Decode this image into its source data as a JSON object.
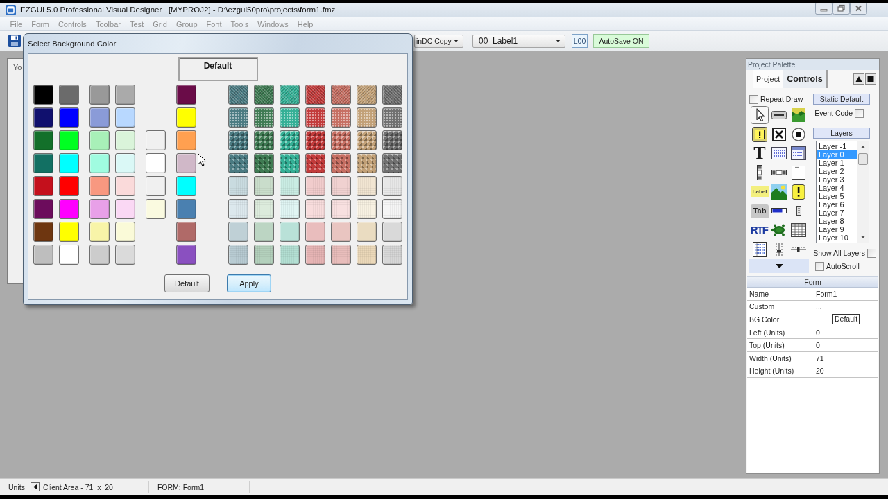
{
  "window": {
    "title": "EZGUI 5.0 Professional Visual Designer   [MYPROJ2] - D:\\ezgui50pro\\projects\\form1.fmz"
  },
  "menu": [
    {
      "label": "File",
      "disabled": true
    },
    {
      "label": "Form",
      "disabled": true
    },
    {
      "label": "Controls",
      "disabled": true
    },
    {
      "label": "Toolbar",
      "disabled": true
    },
    {
      "label": "Test",
      "disabled": true
    },
    {
      "label": "Grid",
      "disabled": true
    },
    {
      "label": "Group",
      "disabled": true
    },
    {
      "label": "Font",
      "disabled": true
    },
    {
      "label": "Tools",
      "disabled": true
    },
    {
      "label": "Windows",
      "disabled": true
    },
    {
      "label": "Help",
      "disabled": true
    }
  ],
  "toolbar": {
    "copy_mode": "inDC Copy",
    "control_select": "00  Label1",
    "layer_badge": "L00",
    "autosave": "AutoSave ON"
  },
  "form_window": {
    "text": "Yo"
  },
  "dialog": {
    "title": "Select Background Color",
    "preview": "Default",
    "basic_groups": [
      {
        "columns": [
          [
            {
              "color": "#000000"
            },
            {
              "color": "#10106e"
            },
            {
              "color": "#13702a"
            },
            {
              "color": "#127063"
            },
            {
              "color": "#c4101c"
            },
            {
              "color": "#6c0c5c"
            },
            {
              "color": "#6e3610"
            },
            {
              "color": "#bebebe"
            }
          ],
          [
            {
              "color": "#6b6b6b"
            },
            {
              "color": "#0000ff"
            },
            {
              "color": "#00ff22"
            },
            {
              "color": "#00ffff"
            },
            {
              "color": "#ff0000"
            },
            {
              "color": "#ff00ff"
            },
            {
              "color": "#ffff00"
            },
            {
              "color": "#ffffff"
            }
          ]
        ]
      },
      {
        "columns": [
          [
            {
              "color": "#999999"
            },
            {
              "color": "#8a9bd8"
            },
            {
              "color": "#a8f0b8"
            },
            {
              "color": "#a0fce0"
            },
            {
              "color": "#f89880"
            },
            {
              "color": "#e8a0e8"
            },
            {
              "color": "#f8f4a8"
            },
            {
              "color": "#cccccc"
            }
          ],
          [
            {
              "color": "#aaaaaa"
            },
            {
              "color": "#b8d8ff"
            },
            {
              "color": "#daf4da"
            },
            {
              "color": "#daf8f6"
            },
            {
              "color": "#fadada"
            },
            {
              "color": "#fad8f4"
            },
            {
              "color": "#fafad8"
            },
            {
              "color": "#dadada"
            }
          ]
        ]
      },
      {
        "columns": [
          [
            {
              "color": "#f0f0f0"
            },
            {
              "color": "#ffffff"
            },
            {
              "color": "#f0f0f0"
            },
            {
              "color": "#fafae0"
            }
          ]
        ]
      },
      {
        "columns": [
          [
            {
              "color": "#6a0c48"
            },
            {
              "color": "#ffff00"
            },
            {
              "color": "#ffa050"
            },
            {
              "color": "#d0b8c8"
            },
            {
              "color": "#00ffff"
            },
            {
              "color": "#4a80b0"
            },
            {
              "color": "#b06a68"
            },
            {
              "color": "#8a50c0"
            }
          ]
        ]
      }
    ],
    "textured_columns": [
      [
        {
          "color": "#4b7b82",
          "kind": "mesh"
        },
        {
          "color": "#4b7b82",
          "kind": "dots"
        },
        {
          "color": "#4b7b82",
          "kind": "studs"
        },
        {
          "color": "#4b7b82",
          "kind": "pyramids"
        },
        {
          "color": "#c9dbe0",
          "kind": "speckle"
        },
        {
          "color": "#dce8ed",
          "kind": "speckle"
        },
        {
          "color": "#bfd0d6",
          "kind": "solid"
        },
        {
          "color": "#b8cbd2",
          "kind": "speckle"
        }
      ],
      [
        {
          "color": "#3f7b53",
          "kind": "mesh"
        },
        {
          "color": "#3f7b53",
          "kind": "dots"
        },
        {
          "color": "#3f7b53",
          "kind": "studs"
        },
        {
          "color": "#3f7b53",
          "kind": "pyramids"
        },
        {
          "color": "#c9ddcb",
          "kind": "speckle"
        },
        {
          "color": "#dcebdc",
          "kind": "speckle"
        },
        {
          "color": "#bcd5c3",
          "kind": "solid"
        },
        {
          "color": "#b3d0bc",
          "kind": "speckle"
        }
      ],
      [
        {
          "color": "#35b096",
          "kind": "mesh"
        },
        {
          "color": "#35b096",
          "kind": "dots"
        },
        {
          "color": "#35b096",
          "kind": "studs"
        },
        {
          "color": "#35b096",
          "kind": "pyramids"
        },
        {
          "color": "#c9ece3",
          "kind": "speckle"
        },
        {
          "color": "#e0f5f3",
          "kind": "speckle"
        },
        {
          "color": "#b9e1d8",
          "kind": "solid"
        },
        {
          "color": "#b3dfd3",
          "kind": "speckle"
        }
      ],
      [
        {
          "color": "#c23b3b",
          "kind": "mesh"
        },
        {
          "color": "#c23b3b",
          "kind": "dots"
        },
        {
          "color": "#c23b3b",
          "kind": "studs"
        },
        {
          "color": "#c23b3b",
          "kind": "pyramids"
        },
        {
          "color": "#f1cccc",
          "kind": "speckle"
        },
        {
          "color": "#f8dcdc",
          "kind": "speckle"
        },
        {
          "color": "#e9bdbd",
          "kind": "solid"
        },
        {
          "color": "#e6b4b4",
          "kind": "speckle"
        }
      ],
      [
        {
          "color": "#c66f63",
          "kind": "mesh"
        },
        {
          "color": "#c66f63",
          "kind": "dots"
        },
        {
          "color": "#c66f63",
          "kind": "studs"
        },
        {
          "color": "#c66f63",
          "kind": "pyramids"
        },
        {
          "color": "#f0d1d0",
          "kind": "speckle"
        },
        {
          "color": "#f8e0e0",
          "kind": "speckle"
        },
        {
          "color": "#e9c5c1",
          "kind": "solid"
        },
        {
          "color": "#e8bdbb",
          "kind": "speckle"
        }
      ],
      [
        {
          "color": "#c2a178",
          "kind": "mesh"
        },
        {
          "color": "#c2a178",
          "kind": "dots"
        },
        {
          "color": "#c2a178",
          "kind": "studs"
        },
        {
          "color": "#c2a178",
          "kind": "pyramids"
        },
        {
          "color": "#f1e5d2",
          "kind": "speckle"
        },
        {
          "color": "#f8f1e2",
          "kind": "speckle"
        },
        {
          "color": "#eadcc1",
          "kind": "solid"
        },
        {
          "color": "#ebd8b9",
          "kind": "speckle"
        }
      ],
      [
        {
          "color": "#707070",
          "kind": "mesh"
        },
        {
          "color": "#707070",
          "kind": "dots"
        },
        {
          "color": "#707070",
          "kind": "studs"
        },
        {
          "color": "#707070",
          "kind": "pyramids"
        },
        {
          "color": "#e7e7e7",
          "kind": "speckle"
        },
        {
          "color": "#f5f5f5",
          "kind": "speckle"
        },
        {
          "color": "#d9d9d9",
          "kind": "solid"
        },
        {
          "color": "#d7d7d7",
          "kind": "speckle"
        }
      ]
    ],
    "buttons": [
      {
        "label": "Default",
        "focused": false
      },
      {
        "label": "Apply",
        "focused": true
      }
    ]
  },
  "palette": {
    "title": "Project Palette",
    "tabs": [
      {
        "label": "Project",
        "selected": false
      },
      {
        "label": "Controls",
        "selected": true
      }
    ],
    "repeat_draw": {
      "label": "Repeat Draw",
      "checked": false
    },
    "static_default": "Static Default",
    "event_code": {
      "label": "Event Code",
      "checked": false
    },
    "layers_button": "Layers",
    "layers": [
      {
        "label": "Layer -1",
        "selected": false
      },
      {
        "label": "Layer 0",
        "selected": true
      },
      {
        "label": "Layer 1",
        "selected": false
      },
      {
        "label": "Layer 2",
        "selected": false
      },
      {
        "label": "Layer 3",
        "selected": false
      },
      {
        "label": "Layer 4",
        "selected": false
      },
      {
        "label": "Layer 5",
        "selected": false
      },
      {
        "label": "Layer 6",
        "selected": false
      },
      {
        "label": "Layer 7",
        "selected": false
      },
      {
        "label": "Layer 8",
        "selected": false
      },
      {
        "label": "Layer 9",
        "selected": false
      },
      {
        "label": "Layer 10",
        "selected": false
      }
    ],
    "show_all_layers": {
      "label": "Show All Layers",
      "checked": false
    },
    "auto_scroll": {
      "label": "AutoScroll",
      "checked": false
    },
    "tools": [
      {
        "kind": "pointer",
        "selected": true
      },
      {
        "kind": "button",
        "selected": false
      },
      {
        "kind": "image",
        "selected": false
      },
      {
        "kind": "frame_alert",
        "selected": false
      },
      {
        "kind": "checkbox",
        "selected": false
      },
      {
        "kind": "radio",
        "selected": false
      },
      {
        "kind": "text",
        "text": "T",
        "selected": false
      },
      {
        "kind": "list",
        "selected": false
      },
      {
        "kind": "combo",
        "selected": false
      },
      {
        "kind": "vscroll",
        "selected": false
      },
      {
        "kind": "hscroll",
        "selected": false
      },
      {
        "kind": "frame",
        "selected": false
      },
      {
        "kind": "label",
        "text": "Label",
        "selected": false
      },
      {
        "kind": "picture",
        "selected": false
      },
      {
        "kind": "alert",
        "selected": false
      },
      {
        "kind": "tab",
        "text": "Tab",
        "selected": false
      },
      {
        "kind": "progress",
        "selected": false
      },
      {
        "kind": "updown",
        "selected": false
      },
      {
        "kind": "rtf",
        "text": "RTF",
        "selected": false
      },
      {
        "kind": "turtle",
        "selected": false
      },
      {
        "kind": "grid",
        "selected": false
      },
      {
        "kind": "listview",
        "selected": false
      },
      {
        "kind": "vtrack",
        "selected": false
      },
      {
        "kind": "htrack",
        "selected": false
      }
    ],
    "properties": {
      "header": "Form",
      "rows": [
        {
          "name": "Name",
          "value": "Form1",
          "kind": "text"
        },
        {
          "name": "Custom",
          "value": "...",
          "kind": "text"
        },
        {
          "name": "BG Color",
          "value": "Default",
          "kind": "button"
        },
        {
          "name": "Left (Units)",
          "value": "0",
          "kind": "text"
        },
        {
          "name": "Top (Units)",
          "value": "0",
          "kind": "text"
        },
        {
          "name": "Width (Units)",
          "value": "71",
          "kind": "text"
        },
        {
          "name": "Height (Units)",
          "value": "20",
          "kind": "text"
        }
      ]
    }
  },
  "status_bar": {
    "units": "Units",
    "client_area": "Client Area - 71  x  20",
    "form": "FORM: Form1"
  }
}
